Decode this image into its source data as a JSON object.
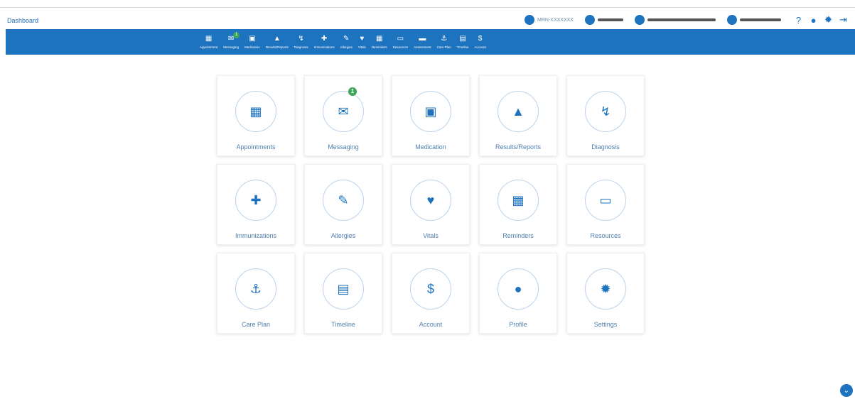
{
  "header": {
    "title": "Dashboard",
    "user_info": [
      {
        "icon": "id-card-icon",
        "text": "MRN-XXXXXXX",
        "redact_width": 0
      },
      {
        "icon": "user-circle-icon",
        "text": "",
        "redact_width": 36
      },
      {
        "icon": "calendar-icon",
        "text": "",
        "redact_width": 96
      },
      {
        "icon": "phone-icon",
        "text": "",
        "redact_width": 58
      }
    ],
    "actions": [
      {
        "name": "help-icon",
        "glyph": "?"
      },
      {
        "name": "profile-icon",
        "glyph": "●"
      },
      {
        "name": "settings-gear-icon",
        "glyph": "✹"
      },
      {
        "name": "logout-icon",
        "glyph": "⇥"
      }
    ]
  },
  "nav": {
    "items": [
      {
        "label": "Appointment",
        "icon": "calendar-icon",
        "glyph": "▦",
        "badge": ""
      },
      {
        "label": "Messaging",
        "icon": "envelope-icon",
        "glyph": "✉",
        "badge": "1"
      },
      {
        "label": "Medication",
        "icon": "medkit-icon",
        "glyph": "▣",
        "badge": ""
      },
      {
        "label": "Results/Reports",
        "icon": "flask-icon",
        "glyph": "▲",
        "badge": ""
      },
      {
        "label": "Diagnosis",
        "icon": "stethoscope-icon",
        "glyph": "↯",
        "badge": ""
      },
      {
        "label": "Immunizations",
        "icon": "plus-square-icon",
        "glyph": "✚",
        "badge": ""
      },
      {
        "label": "Allergies",
        "icon": "pencil-icon",
        "glyph": "✎",
        "badge": ""
      },
      {
        "label": "Vitals",
        "icon": "heartbeat-icon",
        "glyph": "♥",
        "badge": ""
      },
      {
        "label": "Reminders",
        "icon": "calendar-icon",
        "glyph": "▦",
        "badge": ""
      },
      {
        "label": "Resources",
        "icon": "folder-icon",
        "glyph": "▭",
        "badge": ""
      },
      {
        "label": "Assessment",
        "icon": "list-icon",
        "glyph": "▬",
        "badge": ""
      },
      {
        "label": "Care Plan",
        "icon": "anchor-icon",
        "glyph": "⚓",
        "badge": ""
      },
      {
        "label": "Timeline",
        "icon": "document-icon",
        "glyph": "▤",
        "badge": ""
      },
      {
        "label": "Account",
        "icon": "dollar-icon",
        "glyph": "$",
        "badge": ""
      }
    ]
  },
  "tiles": [
    {
      "label": "Appointments",
      "icon": "calendar-check-icon",
      "glyph": "▦",
      "badge": ""
    },
    {
      "label": "Messaging",
      "icon": "envelope-icon",
      "glyph": "✉",
      "badge": "1"
    },
    {
      "label": "Medication",
      "icon": "medkit-icon",
      "glyph": "▣",
      "badge": ""
    },
    {
      "label": "Results/Reports",
      "icon": "flask-icon",
      "glyph": "▲",
      "badge": ""
    },
    {
      "label": "Diagnosis",
      "icon": "stethoscope-icon",
      "glyph": "↯",
      "badge": ""
    },
    {
      "label": "Immunizations",
      "icon": "plus-square-icon",
      "glyph": "✚",
      "badge": ""
    },
    {
      "label": "Allergies",
      "icon": "pill-icon",
      "glyph": "✎",
      "badge": ""
    },
    {
      "label": "Vitals",
      "icon": "heartbeat-icon",
      "glyph": "♥",
      "badge": ""
    },
    {
      "label": "Reminders",
      "icon": "calendar-icon",
      "glyph": "▦",
      "badge": ""
    },
    {
      "label": "Resources",
      "icon": "folder-open-icon",
      "glyph": "▭",
      "badge": ""
    },
    {
      "label": "Care Plan",
      "icon": "anchor-icon",
      "glyph": "⚓",
      "badge": ""
    },
    {
      "label": "Timeline",
      "icon": "document-icon",
      "glyph": "▤",
      "badge": ""
    },
    {
      "label": "Account",
      "icon": "dollar-icon",
      "glyph": "$",
      "badge": ""
    },
    {
      "label": "Profile",
      "icon": "user-icon",
      "glyph": "●",
      "badge": ""
    },
    {
      "label": "Settings",
      "icon": "gear-icon",
      "glyph": "✹",
      "badge": ""
    }
  ],
  "fab": {
    "icon": "chevron-down-icon",
    "glyph": "⌄"
  },
  "colors": {
    "primary": "#1e73be",
    "badge": "#3aa857",
    "label": "#4f7fae"
  }
}
